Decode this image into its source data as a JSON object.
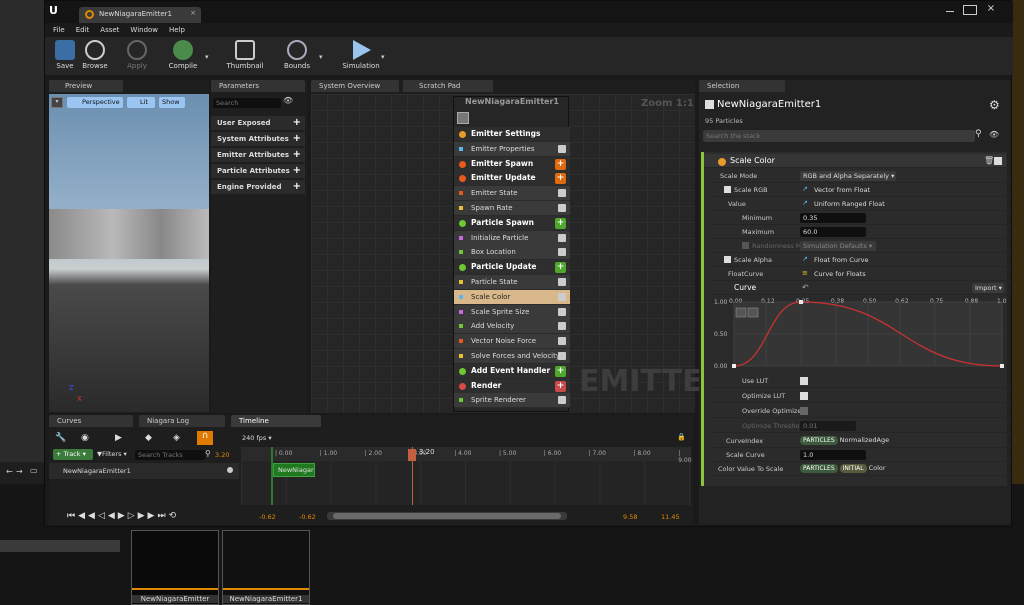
{
  "window": {
    "tab_title": "NewNiagaraEmitter1"
  },
  "menu": [
    "File",
    "Edit",
    "Asset",
    "Window",
    "Help"
  ],
  "toolbar": {
    "save": "Save",
    "browse": "Browse",
    "apply": "Apply",
    "compile": "Compile",
    "thumbnail": "Thumbnail",
    "bounds": "Bounds",
    "simulation": "Simulation"
  },
  "preview": {
    "tab": "Preview",
    "perspective": "Perspective",
    "lit": "Lit",
    "show": "Show",
    "axis_z": "Z",
    "axis_x": "X"
  },
  "parameters": {
    "tab": "Parameters",
    "search_placeholder": "Search",
    "items": [
      "User Exposed",
      "System Attributes",
      "Emitter Attributes",
      "Particle Attributes",
      "Engine Provided"
    ]
  },
  "graph": {
    "tab_overview": "System Overview",
    "tab_scratch": "Scratch Pad",
    "node_title": "NewNiagaraEmitter1",
    "zoom": "Zoom 1:1",
    "watermark": "EMITTER",
    "rows": [
      {
        "label": "Emitter Settings",
        "type": "hdr"
      },
      {
        "label": "Emitter Properties",
        "type": "row"
      },
      {
        "label": "Emitter Spawn",
        "type": "hdr"
      },
      {
        "label": "Emitter Update",
        "type": "hdr"
      },
      {
        "label": "Emitter State",
        "type": "row"
      },
      {
        "label": "Spawn Rate",
        "type": "row"
      },
      {
        "label": "Particle Spawn",
        "type": "hdr"
      },
      {
        "label": "Initialize Particle",
        "type": "row"
      },
      {
        "label": "Box Location",
        "type": "row"
      },
      {
        "label": "Particle Update",
        "type": "hdr"
      },
      {
        "label": "Particle State",
        "type": "row"
      },
      {
        "label": "Scale Color",
        "type": "sel"
      },
      {
        "label": "Scale Sprite Size",
        "type": "row"
      },
      {
        "label": "Add Velocity",
        "type": "row"
      },
      {
        "label": "Vector Noise Force",
        "type": "row"
      },
      {
        "label": "Solve Forces and Velocity",
        "type": "row"
      },
      {
        "label": "Add Event Handler",
        "type": "hdr"
      },
      {
        "label": "Render",
        "type": "hdr"
      },
      {
        "label": "Sprite Renderer",
        "type": "row"
      }
    ]
  },
  "selection": {
    "tab": "Selection",
    "emitter_name": "NewNiagaraEmitter1",
    "particles": "95 Particles",
    "search_placeholder": "Search the stack",
    "module": "Scale Color",
    "scale_mode_label": "Scale Mode",
    "scale_mode_value": "RGB and Alpha Separately",
    "scale_rgb_label": "Scale RGB",
    "scale_rgb_value": "Vector from Float",
    "value_label": "Value",
    "value_value": "Uniform Ranged Float",
    "minimum_label": "Minimum",
    "minimum_value": "0.35",
    "maximum_label": "Maximum",
    "maximum_value": "60.0",
    "randomness_label": "Randomness Mo",
    "randomness_value": "Simulation Defaults",
    "scale_alpha_label": "Scale Alpha",
    "scale_alpha_value": "Float from Curve",
    "floatcurve_label": "FloatCurve",
    "floatcurve_value": "Curve for Floats",
    "curve_label": "Curve",
    "import": "Import",
    "curve_ticks_x": [
      "0.00",
      "0.12",
      "0.25",
      "0.38",
      "0.50",
      "0.62",
      "0.75",
      "0.88",
      "1.00"
    ],
    "curve_ticks_y": [
      "1.00",
      "0.50",
      "0.00"
    ],
    "use_lut": "Use LUT",
    "optimize_lut": "Optimize LUT",
    "override_optimize": "Override Optimize",
    "optimize_threshold_label": "Optimize Threshold",
    "optimize_threshold_value": "0.01",
    "curveindex_label": "CurveIndex",
    "curveindex_pill": "PARTICLES",
    "curveindex_value": "NormalizedAge",
    "scale_curve_label": "Scale Curve",
    "scale_curve_value": "1.0",
    "cvts_label": "Color Value To Scale",
    "cvts_pill1": "PARTICLES",
    "cvts_pill2": "INITIAL",
    "cvts_value": "Color"
  },
  "timeline": {
    "tab_curves": "Curves",
    "tab_log": "Niagara Log",
    "tab_timeline": "Timeline",
    "fps": "240 fps",
    "track": "Track",
    "filters": "Filters",
    "search_placeholder": "Search Tracks",
    "time_value": "3.20",
    "cursor_label": "3.20",
    "ticks": [
      "0.00",
      "1.00",
      "2.00",
      "3.00",
      "4.00",
      "5.00",
      "6.00",
      "7.00",
      "8.00",
      "9.00"
    ],
    "row_name": "NewNiagaraEmitter1",
    "bar_label": "NewNiagar",
    "range": [
      "-0.62",
      "-0.62",
      "9.58",
      "11.45"
    ]
  },
  "content_browser": {
    "thumbs": [
      "NewNiagaraEmitter",
      "NewNiagaraEmitter1"
    ]
  },
  "chart_data": {
    "type": "line",
    "x": [
      0.0,
      0.25,
      1.0
    ],
    "y": [
      0.0,
      1.0,
      0.0
    ],
    "xlim": [
      0,
      1
    ],
    "ylim": [
      0,
      1
    ]
  }
}
